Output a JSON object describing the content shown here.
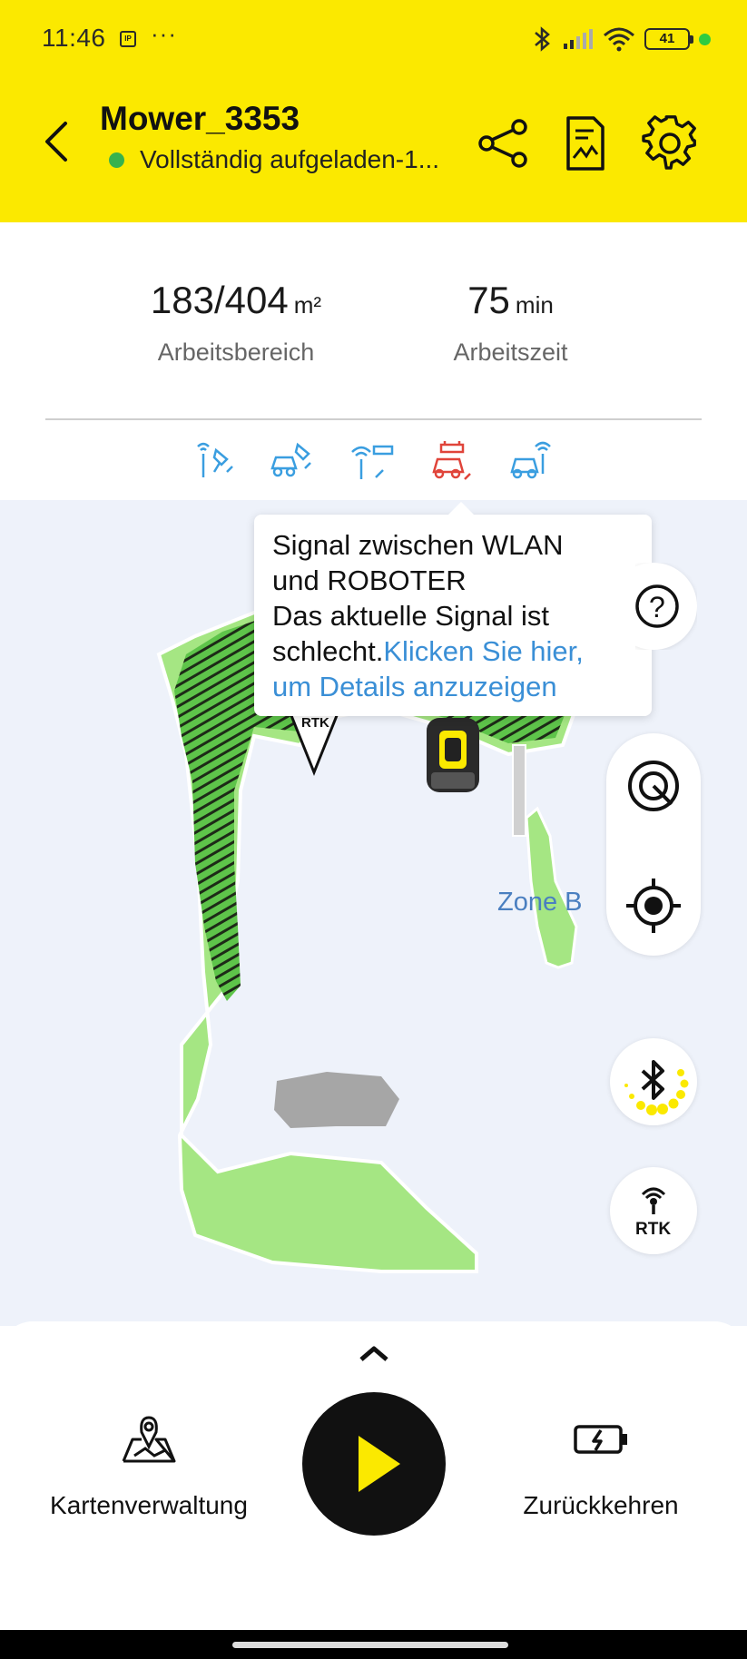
{
  "status_bar": {
    "time": "11:46",
    "ip_badge": "IP",
    "more": "···",
    "battery": "41",
    "icons": [
      "bluetooth-icon",
      "cellular-signal-icon",
      "wifi-icon",
      "battery-icon"
    ]
  },
  "header": {
    "device_name": "Mower_3353",
    "device_status": "Vollständig aufgeladen-1...",
    "status_color": "#37b24d",
    "background": "#fbe900",
    "actions": [
      "share-icon",
      "report-icon",
      "settings-icon"
    ]
  },
  "stats": {
    "area_value": "183/404",
    "area_unit": "m²",
    "area_label": "Arbeitsbereich",
    "time_value": "75",
    "time_unit": "min",
    "time_label": "Arbeitszeit"
  },
  "signal_icons": [
    {
      "name": "rtk-to-station-signal-icon",
      "state": "ok",
      "color": "#3a9ee0"
    },
    {
      "name": "station-to-robot-signal-icon",
      "state": "ok",
      "color": "#3a9ee0"
    },
    {
      "name": "wifi-to-station-signal-icon",
      "state": "ok",
      "color": "#3a9ee0"
    },
    {
      "name": "wifi-to-robot-signal-icon",
      "state": "bad",
      "color": "#e0443a"
    },
    {
      "name": "robot-cloud-signal-icon",
      "state": "ok",
      "color": "#3a9ee0"
    }
  ],
  "tooltip": {
    "line1": "Signal zwischen WLAN",
    "line2": "und ROBOTER",
    "line3": "Das aktuelle Signal ist",
    "line4": "schlecht.",
    "link_part1": "Klicken Sie hier,",
    "link_part2": "um Details anzuzeigen"
  },
  "map": {
    "zone_b_label": "Zone B",
    "rtk_marker": "RTK",
    "lawn_color": "#a5e683",
    "mowed_color": "#5ec44a",
    "obstacle_color": "#a6a6a6"
  },
  "map_controls": {
    "help": "?",
    "rtk_button": "RTK"
  },
  "bottom": {
    "map_management": "Kartenverwaltung",
    "return": "Zurückkehren"
  }
}
